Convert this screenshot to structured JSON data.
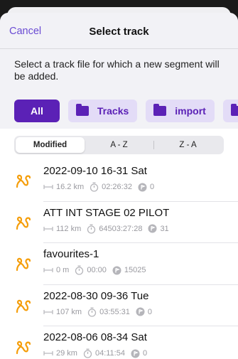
{
  "header": {
    "cancel_label": "Cancel",
    "title": "Select track"
  },
  "description": "Select a track file for which a new segment will be added.",
  "chips": [
    {
      "label": "All",
      "active": true
    },
    {
      "label": "Tracks",
      "icon": "folder-icon"
    },
    {
      "label": "import",
      "icon": "folder-icon"
    },
    {
      "label": "",
      "icon": "folder-icon"
    }
  ],
  "sort": {
    "options": [
      "Modified",
      "A - Z",
      "Z - A"
    ],
    "selected": "Modified"
  },
  "tracks": [
    {
      "name": "2022-09-10 16-31 Sat",
      "distance": "16.2 km",
      "duration": "02:26:32",
      "points": "0"
    },
    {
      "name": "ATT INT STAGE 02 PILOT",
      "distance": "112 km",
      "duration": "64503:27:28",
      "points": "31"
    },
    {
      "name": "favourites-1",
      "distance": "0 m",
      "duration": "00:00",
      "points": "15025"
    },
    {
      "name": "2022-08-30 09-36 Tue",
      "distance": "107 km",
      "duration": "03:55:31",
      "points": "0"
    },
    {
      "name": "2022-08-06 08-34 Sat",
      "distance": "29 km",
      "duration": "04:11:54",
      "points": "0"
    }
  ],
  "colors": {
    "accent": "#5b21b6",
    "chip_bg": "#e3dcf7",
    "track_icon": "#f59e0b",
    "link": "#6a4bd3"
  }
}
